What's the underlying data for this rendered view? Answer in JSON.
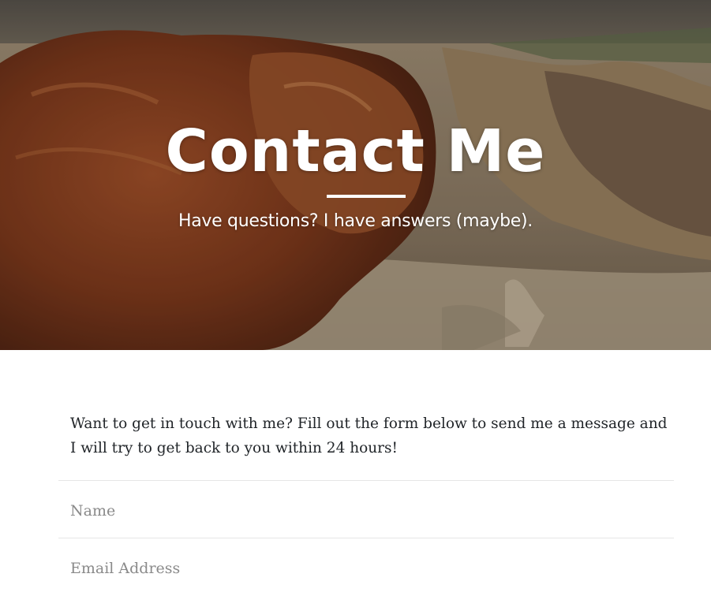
{
  "hero": {
    "title": "Contact Me",
    "subtitle": "Have questions? I have answers (maybe).",
    "image_subject": "highland cow on rocky terrain"
  },
  "intro": {
    "text": "Want to get in touch with me? Fill out the form below to send me a message and I will try to get back to you within 24 hours!"
  },
  "form": {
    "name": {
      "placeholder": "Name",
      "value": ""
    },
    "email": {
      "placeholder": "Email Address",
      "value": ""
    }
  },
  "colors": {
    "hero_text": "#ffffff",
    "body_text": "#212529",
    "placeholder": "#8a8a8a",
    "divider_line": "#e6e6e6"
  }
}
